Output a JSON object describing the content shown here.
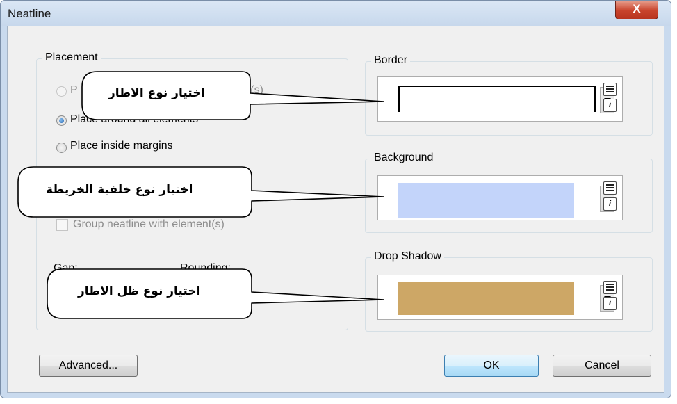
{
  "window": {
    "title": "Neatline",
    "close_label": "X"
  },
  "placement": {
    "label": "Placement",
    "options": [
      {
        "label": "P",
        "label_tail": "ent(s)",
        "checked": false,
        "disabled": true
      },
      {
        "label": "Place around all elements",
        "checked": true,
        "disabled": false
      },
      {
        "label": "Place inside margins",
        "checked": false,
        "disabled": false
      }
    ],
    "group_check_label": "Group neatline with element(s)",
    "gap_label": "Gap:",
    "rounding_label": "Rounding:"
  },
  "border": {
    "label": "Border"
  },
  "background": {
    "label": "Background",
    "color": "#c3d4fa"
  },
  "drop_shadow": {
    "label": "Drop Shadow",
    "color": "#cda766"
  },
  "mini_buttons": {
    "info_glyph": "i"
  },
  "buttons": {
    "advanced": "Advanced...",
    "ok": "OK",
    "cancel": "Cancel"
  },
  "callouts": [
    {
      "text": "اختيار نوع الاطار"
    },
    {
      "text": "اختيار نوع خلفية الخريطة"
    },
    {
      "text": "اختيار نوع ظل الاطار"
    }
  ]
}
